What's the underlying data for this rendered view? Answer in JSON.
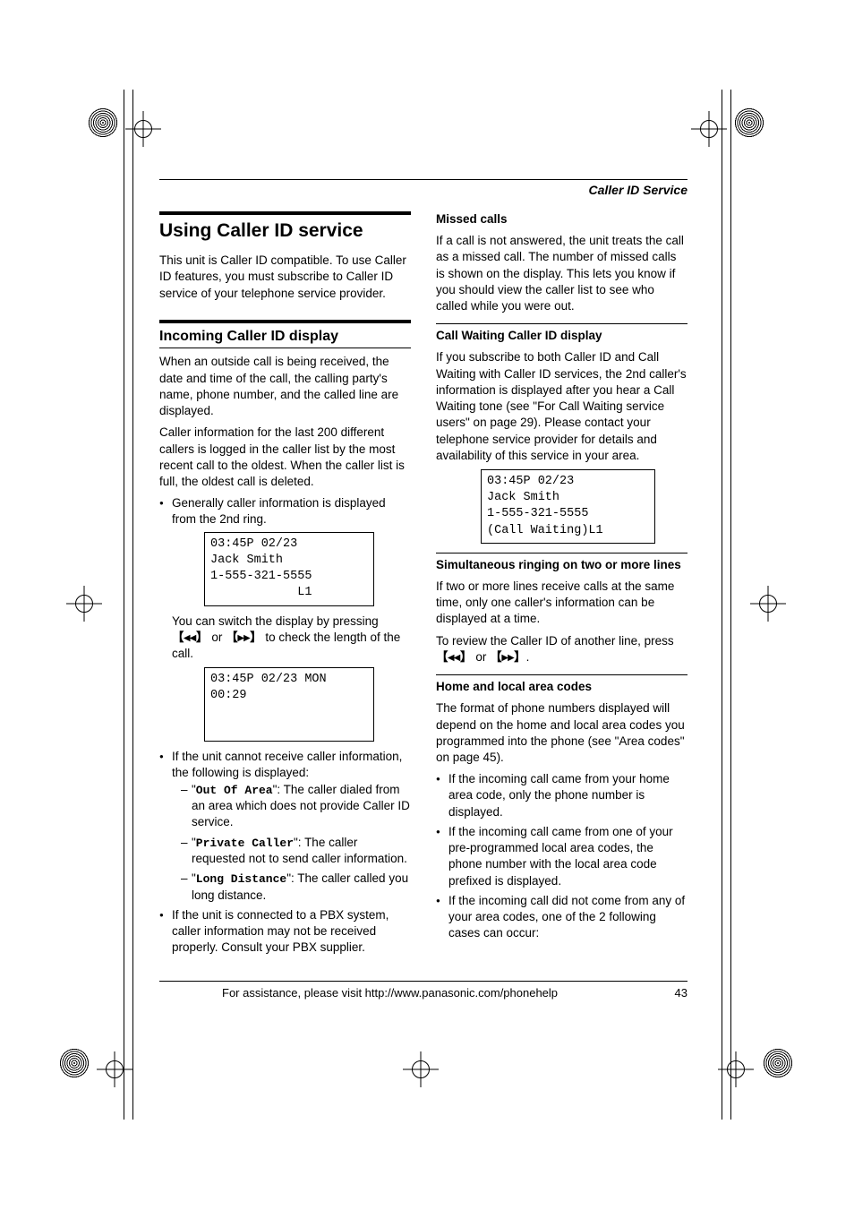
{
  "header": {
    "section": "Caller ID Service"
  },
  "left": {
    "h1": "Using Caller ID service",
    "intro": "This unit is Caller ID compatible. To use Caller ID features, you must subscribe to Caller ID service of your telephone service provider.",
    "h2": "Incoming Caller ID display",
    "p1": "When an outside call is being received, the date and time of the call, the calling party's name, phone number, and the called line are displayed.",
    "p2": "Caller information for the last 200 different callers is logged in the caller list by the most recent call to the oldest. When the caller list is full, the oldest call is deleted.",
    "b1": "Generally caller information is displayed from the 2nd ring.",
    "lcd1": "03:45P 02/23\nJack Smith\n1-555-321-5555\n            L1",
    "switch1": "You can switch the display by pressing ",
    "switch2": " or ",
    "switch3": " to check the length of the call.",
    "lcd2": "03:45P 02/23 MON\n00:29\n \n ",
    "b2a": "If the unit cannot receive caller information, the following is displayed:",
    "d1code": "Out Of Area",
    "d1txt": "\": The caller dialed from an area which does not provide Caller ID service.",
    "d2code": "Private Caller",
    "d2txt": "\": The caller requested not to send caller information.",
    "d3code": "Long Distance",
    "d3txt": "\": The caller called you long distance.",
    "b3": "If the unit is connected to a PBX system, caller information may not be received properly. Consult your PBX supplier."
  },
  "right": {
    "h_missed": "Missed calls",
    "p_missed": "If a call is not answered, the unit treats the call as a missed call. The number of missed calls is shown on the display. This lets you know if you should view the caller list to see who called while you were out.",
    "h_cw": "Call Waiting Caller ID display",
    "p_cw": "If you subscribe to both Caller ID and Call Waiting with Caller ID services, the 2nd caller's information is displayed after you hear a Call Waiting tone (see \"For Call Waiting service users\" on page 29). Please contact your telephone service provider for details and availability of this service in your area.",
    "lcd_cw": "03:45P 02/23\nJack Smith\n1-555-321-5555\n(Call Waiting)L1",
    "h_sim": "Simultaneous ringing on two or more lines",
    "p_sim": "If two or more lines receive calls at the same time, only one caller's information can be displayed at a time.",
    "p_review1": "To review the Caller ID of another line, press ",
    "p_review2": " or ",
    "p_review3": ".",
    "h_area": "Home and local area codes",
    "p_area": "The format of phone numbers displayed will depend on the home and local area codes you programmed into the phone (see \"Area codes\" on page 45).",
    "ab1": "If the incoming call came from your home area code, only the phone number is displayed.",
    "ab2": "If the incoming call came from one of your pre-programmed local area codes, the phone number with the local area code prefixed is displayed.",
    "ab3": "If the incoming call did not come from any of your area codes, one of the 2 following cases can occur:"
  },
  "footer": {
    "help": "For assistance, please visit http://www.panasonic.com/phonehelp",
    "page": "43"
  },
  "keys": {
    "rew": "【◂◂】",
    "ff": "【▸▸】"
  }
}
